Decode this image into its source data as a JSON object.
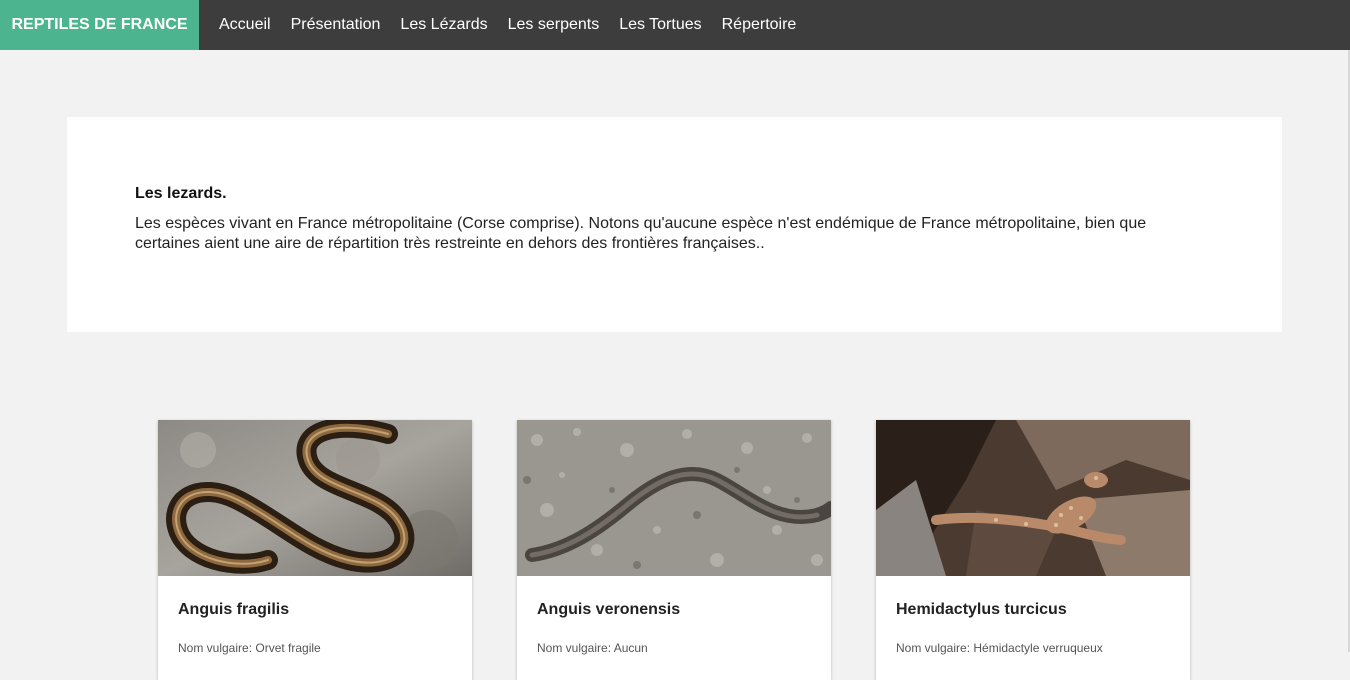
{
  "nav": {
    "brand": "REPTILES DE FRANCE",
    "items": [
      {
        "label": "Accueil"
      },
      {
        "label": "Présentation"
      },
      {
        "label": "Les Lézards"
      },
      {
        "label": "Les serpents"
      },
      {
        "label": "Les Tortues"
      },
      {
        "label": "Répertoire"
      }
    ]
  },
  "intro": {
    "title": "Les lezards.",
    "text": "Les espèces vivant en France métropolitaine (Corse comprise). Notons qu'aucune espèce n'est endémique de France métropolitaine, bien que certaines aient une aire de répartition très restreinte en dehors des frontières françaises.."
  },
  "cards": [
    {
      "title": "Anguis fragilis",
      "common_label": "Nom vulgaire:",
      "common_value": "Orvet fragile",
      "image": "slow-worm-photo"
    },
    {
      "title": "Anguis veronensis",
      "common_label": "Nom vulgaire:",
      "common_value": "Aucun",
      "image": "slow-worm-gravel-photo"
    },
    {
      "title": "Hemidactylus turcicus",
      "common_label": "Nom vulgaire:",
      "common_value": "Hémidactyle verruqueux",
      "image": "gecko-bark-photo"
    }
  ],
  "colors": {
    "brand_bg": "#4cb58f",
    "navbar_bg": "#3d3d3d",
    "page_bg": "#f2f2f2"
  }
}
